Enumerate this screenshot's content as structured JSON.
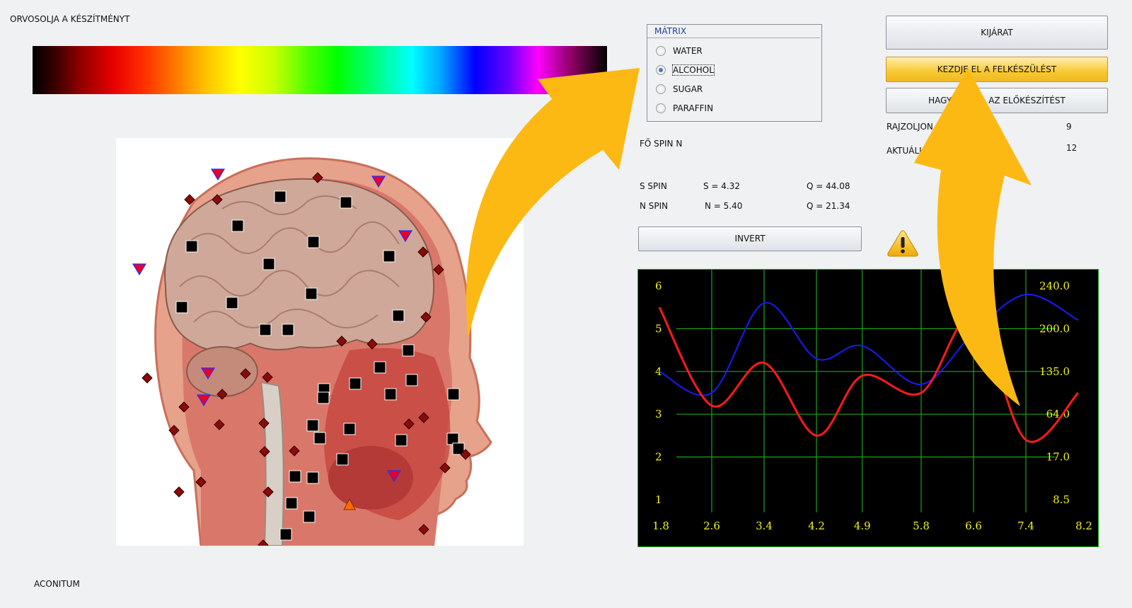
{
  "app_title": "ORVOSOLJA A KÉSZÍTMÉNYT",
  "remedy_name": "ACONITUM",
  "matrix": {
    "title": "MÁTRIX",
    "options": [
      "WATER",
      "ALCOHOL",
      "SUGAR",
      "PARAFFIN"
    ],
    "selected": "ALCOHOL"
  },
  "spin": {
    "main_label": "FŐ SPIN N",
    "s_label": "S SPIN",
    "s_value": "S = 4.32",
    "s_q": "Q = 44.08",
    "n_label": "N SPIN",
    "n_value": "N = 5.40",
    "n_q": "Q = 21.34"
  },
  "buttons": {
    "exit": "KIJÁRAT",
    "start": "KEZDJE EL A FELKÉSZÜLÉST",
    "skip": "HAGYJA ABBA AZ ELŐKÉSZÍTÉST",
    "invert": "INVERT"
  },
  "info": {
    "draw_label": "RAJZOLJON :",
    "draw_value": "9",
    "current_label": "AKTUÁLIS :",
    "current_value": "12"
  },
  "icons": {
    "warning": "warning-icon",
    "arrow_color": "#fdb913"
  },
  "chart_data": {
    "type": "line",
    "x_ticks": [
      "1.8",
      "2.6",
      "3.4",
      "4.2",
      "4.9",
      "5.8",
      "6.6",
      "7.4",
      "8.2"
    ],
    "y_left_ticks": [
      "1",
      "2",
      "3",
      "4",
      "5",
      "6"
    ],
    "y_right_ticks": [
      "8.5",
      "17.0",
      "64.0",
      "135.0",
      "200.0",
      "240.0"
    ],
    "xlim": [
      1.8,
      8.2
    ],
    "ylim": [
      1,
      6
    ],
    "grid": true,
    "series": [
      {
        "color": "#1a1aff",
        "x": [
          1.8,
          2.6,
          3.4,
          4.2,
          4.9,
          5.8,
          6.6,
          7.4,
          8.2
        ],
        "y": [
          4.0,
          3.5,
          5.6,
          4.3,
          4.6,
          3.7,
          4.9,
          5.8,
          5.2
        ]
      },
      {
        "color": "#ff1a1a",
        "x": [
          1.8,
          2.6,
          3.4,
          4.2,
          4.9,
          5.8,
          6.6,
          7.4,
          8.2
        ],
        "y": [
          5.5,
          3.2,
          4.2,
          2.5,
          3.9,
          3.5,
          5.3,
          2.4,
          3.5
        ]
      }
    ]
  }
}
